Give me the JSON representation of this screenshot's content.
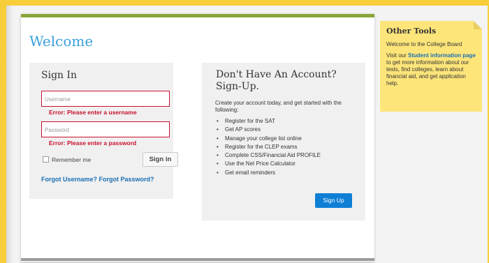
{
  "page_title": "Welcome",
  "signin": {
    "heading": "Sign In",
    "username_placeholder": "Username",
    "username_error": "Error: Please enter a username",
    "password_placeholder": "Password",
    "password_error": "Error: Please enter a password",
    "remember_label": "Remember me",
    "signin_button": "Sign in",
    "forgot_link": "Forgot Username? Forgot Password?"
  },
  "signup": {
    "heading": "Don't Have An Account? Sign-Up.",
    "intro": "Create your account today, and get started with the following:",
    "items": [
      "Register for the SAT",
      "Get AP scores",
      "Manage your college list online",
      "Register for the CLEP exams",
      "Complete CSS/Financial Aid PROFILE",
      "Use the Net Price Calculator",
      "Get email reminders"
    ],
    "signup_button": "Sign Up"
  },
  "other_tools": {
    "title": "Other Tools",
    "welcome_text": "Welcome to the College Board",
    "visit_prefix": "Visit our",
    "link_text": "Student information page",
    "visit_suffix": "to get more information about our tests, find colleges, learn about financial aid, and get application help."
  },
  "colors": {
    "page_background": "#f7ce3a",
    "accent_blue": "#3aa0da",
    "error_red": "#c8102e",
    "header_bar": "#8aa63a",
    "button_blue": "#0f7fd6",
    "note_yellow": "#fde57a"
  }
}
